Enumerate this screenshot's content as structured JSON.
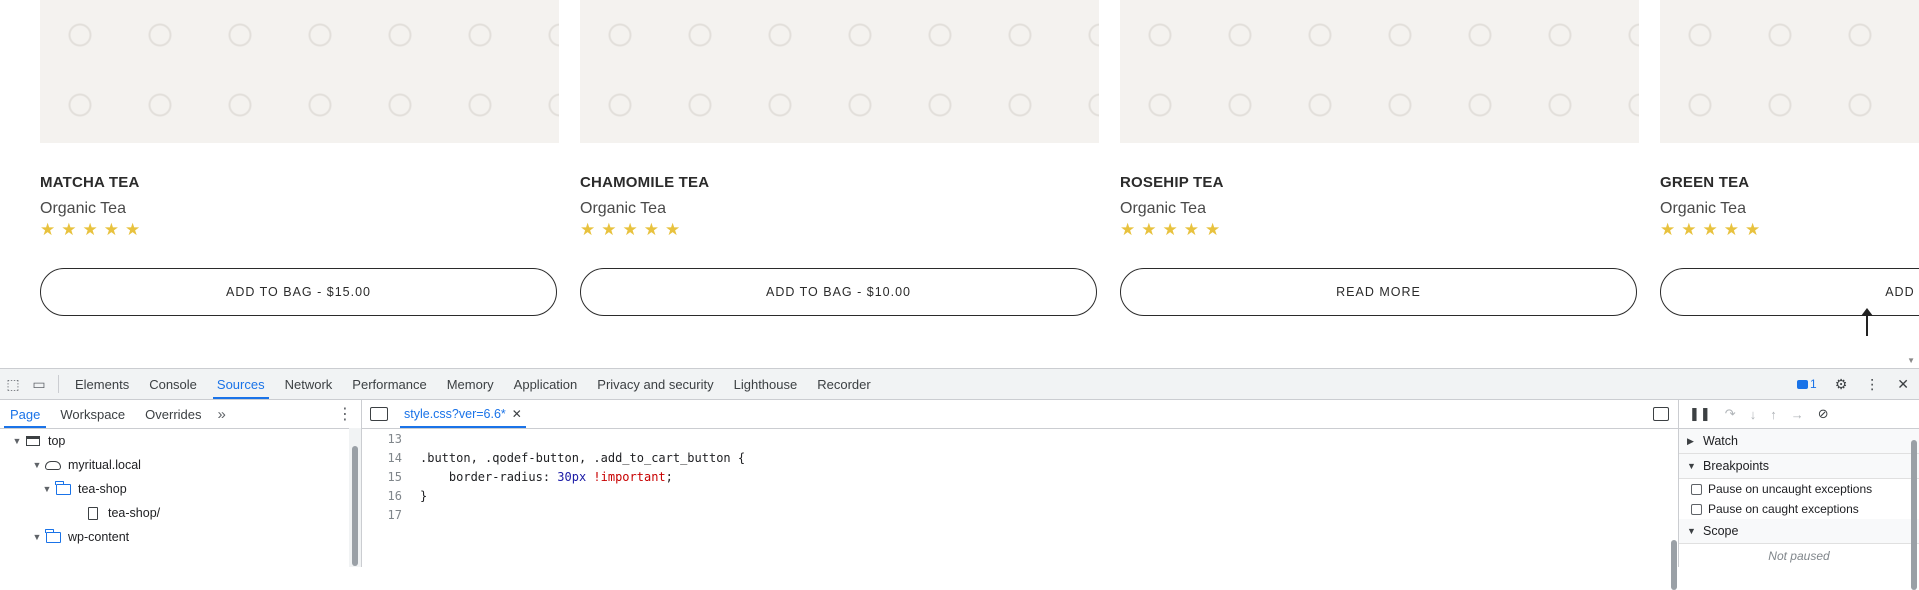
{
  "products": [
    {
      "name": "MATCHA TEA",
      "category": "Organic Tea",
      "rating": 5,
      "button": "ADD TO BAG - $15.00"
    },
    {
      "name": "CHAMOMILE TEA",
      "category": "Organic Tea",
      "rating": 5,
      "button": "ADD TO BAG - $10.00"
    },
    {
      "name": "ROSEHIP TEA",
      "category": "Organic Tea",
      "rating": 5,
      "button": "READ MORE"
    },
    {
      "name": "GREEN TEA",
      "category": "Organic Tea",
      "rating": 5,
      "button": "ADD TO E"
    }
  ],
  "devtools": {
    "tabs": [
      "Elements",
      "Console",
      "Sources",
      "Network",
      "Performance",
      "Memory",
      "Application",
      "Privacy and security",
      "Lighthouse",
      "Recorder"
    ],
    "active_tab": "Sources",
    "issues_count": "1",
    "navigator_tabs": [
      "Page",
      "Workspace",
      "Overrides"
    ],
    "active_navigator_tab": "Page",
    "tree": [
      {
        "label": "top",
        "icon": "frame-icon",
        "expanded": true
      },
      {
        "label": "myritual.local",
        "icon": "cloud-icon",
        "expanded": true
      },
      {
        "label": "tea-shop",
        "icon": "folder-icon",
        "expanded": true
      },
      {
        "label": "tea-shop/",
        "icon": "file-icon",
        "expanded": null
      },
      {
        "label": "wp-content",
        "icon": "folder-icon",
        "expanded": true
      }
    ],
    "editor": {
      "file_tab": "style.css?ver=6.6*",
      "lines": [
        {
          "n": "13",
          "text": ""
        },
        {
          "n": "14",
          "text": ".button, .qodef-button, .add_to_cart_button {"
        },
        {
          "n": "15",
          "prop": "    border-radius: ",
          "value": "30px",
          "important": " !important",
          "end": ";"
        },
        {
          "n": "16",
          "text": "}"
        },
        {
          "n": "17",
          "text": ""
        }
      ]
    },
    "debugger": {
      "watch": "Watch",
      "breakpoints": "Breakpoints",
      "pause_uncaught": "Pause on uncaught exceptions",
      "pause_caught": "Pause on caught exceptions",
      "scope": "Scope",
      "not_paused": "Not paused"
    }
  }
}
